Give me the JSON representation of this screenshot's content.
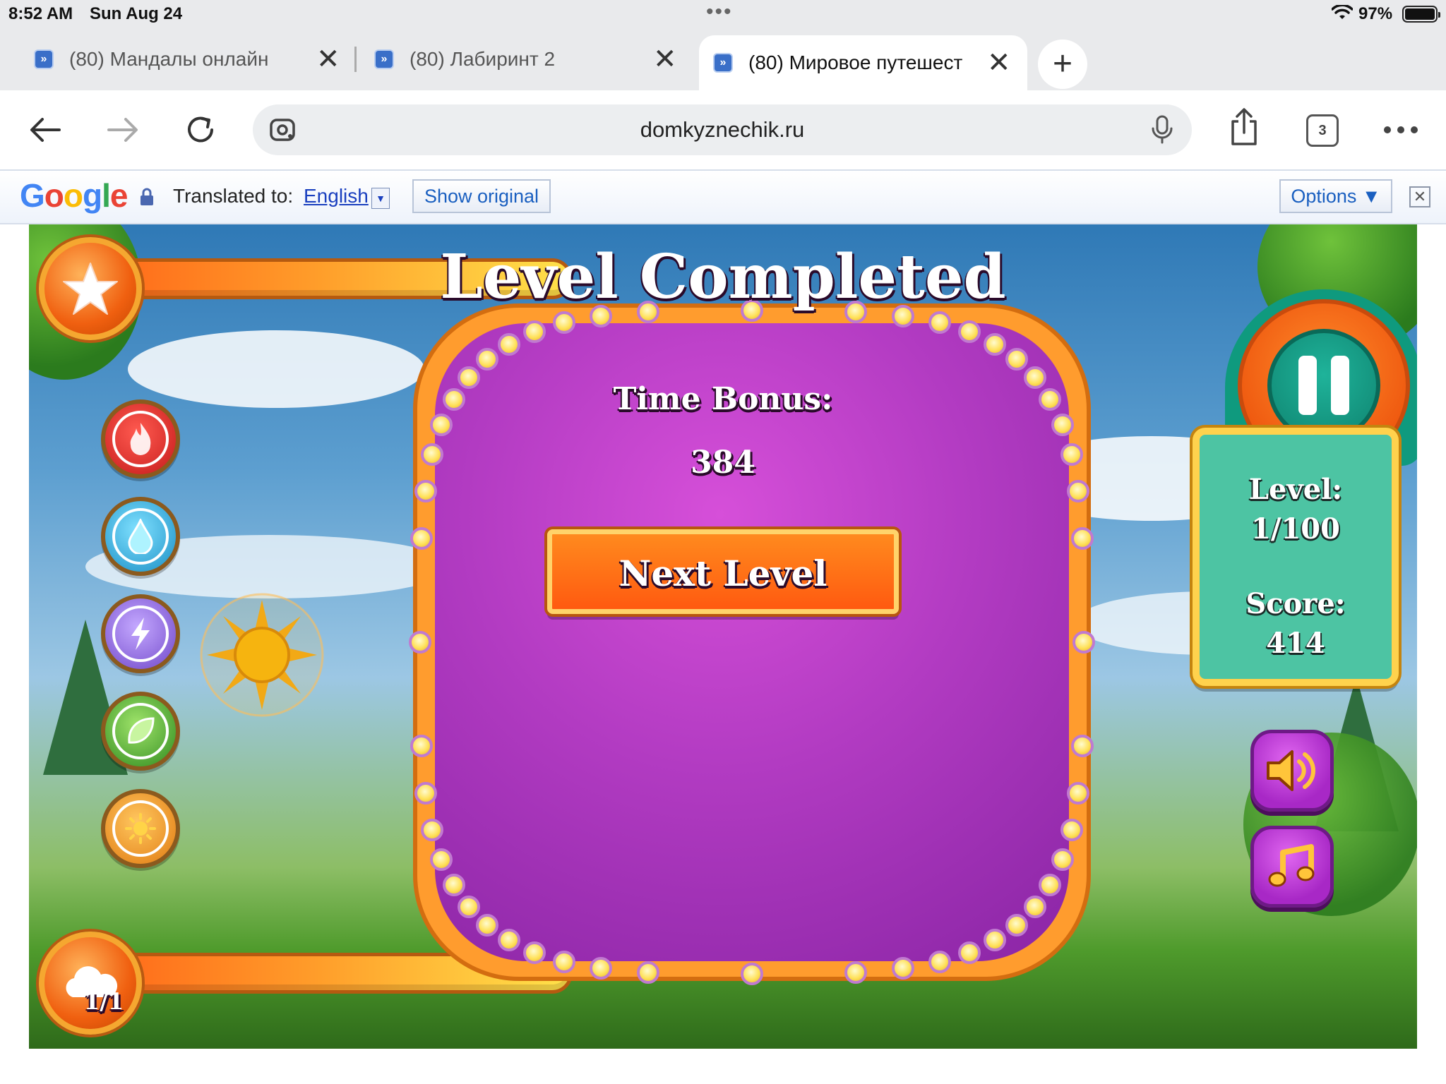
{
  "status_bar": {
    "time": "8:52 AM",
    "date": "Sun Aug 24",
    "battery": "97%"
  },
  "tabs": [
    {
      "title": "(80) Мандалы онлайн",
      "active": false
    },
    {
      "title": "(80) Лабиринт 2",
      "active": false
    },
    {
      "title": "(80) Мировое путешест",
      "active": true
    }
  ],
  "toolbar": {
    "url": "domkyznechik.ru",
    "tab_count": "3"
  },
  "translate_bar": {
    "logo": "Google",
    "translated_to_label": "Translated to:",
    "language": "English",
    "show_original": "Show original",
    "options": "Options ▼"
  },
  "game": {
    "modal": {
      "title": "Level Completed",
      "bonus_label": "Time Bonus:",
      "bonus_value": "384",
      "next_button": "Next Level"
    },
    "stats": {
      "level_label": "Level:",
      "level_value": "1/100",
      "score_label": "Score:",
      "score_value": "414"
    },
    "cloud_counter": "1/1",
    "powers": [
      "fire",
      "water",
      "lightning",
      "leaf",
      "sun"
    ]
  },
  "colors": {
    "modal_purple": "#b23bc2",
    "frame_orange": "#ff9c2e",
    "panel_teal": "#4dc4a3",
    "link_blue": "#1a3fbf"
  }
}
